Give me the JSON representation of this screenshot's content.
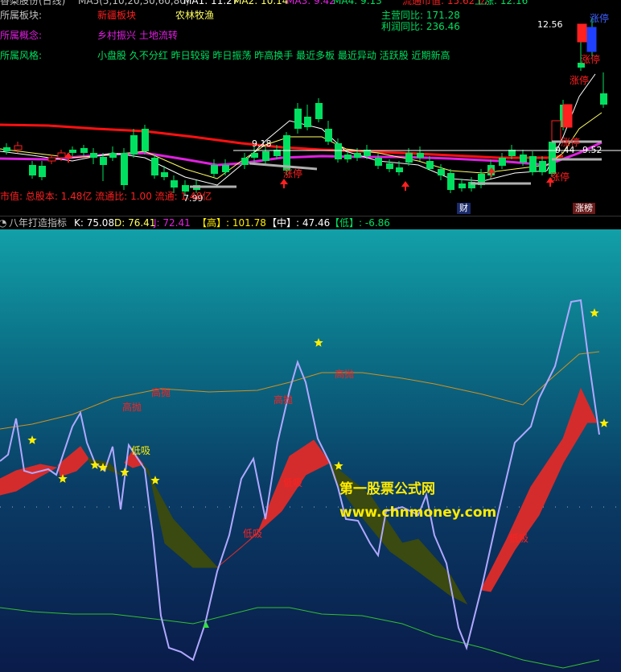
{
  "header": {
    "title": "香梨股份(日线)",
    "ma_line": "MA5(5,10,20,30,60,80)",
    "ma1": "MA1: 11.27",
    "ma2": "MA2: 10.14",
    "ma3": "MA3: 9.42",
    "ma4": "MA4: 9.13",
    "liutong": "流通市值: 15.62 亿",
    "rise": "上涨: 12.16"
  },
  "info": {
    "sector_label": "所属板块:",
    "sector_1": "新疆板块",
    "sector_2": "农林牧渔",
    "concept_label": "所属概念:",
    "concept_value": "乡村振兴 土地流转",
    "style_label": "所属风格:",
    "style_value": "小盘股 久不分红 昨日较弱 昨日振荡 昨高换手 最近多板 最近异动 活跃股 近期新高",
    "revenue_yoy": "主营同比: 171.28",
    "profit_yoy": "利润同比: 236.46"
  },
  "price_labels": {
    "high": "12.56",
    "mid": "9.18",
    "low": "7.99",
    "right_a": "9.44",
    "right_b": "9.52"
  },
  "badges": {
    "zhangting": "涨停",
    "cai": "财",
    "zhangbang": "涨榜"
  },
  "bottom_info": "市值: 总股本: 1.48亿  流通比: 1.00  流通: 1.48亿",
  "indicator": {
    "name": "八年打造指标",
    "k": "K: 75.08",
    "d": "D: 76.41",
    "j": "J: 72.41",
    "gao": "【高】: 101.78",
    "zhong": "【中】: 47.46",
    "di": "【低】: -6.86"
  },
  "signals": {
    "dixi": "低吸",
    "gaopao": "高抛"
  },
  "watermark": {
    "name": "第一股票公式网",
    "url": "www.chnmoney.com"
  },
  "colors": {
    "up": "#ff2020",
    "down": "#00e060",
    "ma_red": "#ff1010",
    "ma_magenta": "#e020e0",
    "ma_yellow": "#ffff60",
    "ribbon_up": "#d42c2c",
    "ribbon_down": "#3a4a10",
    "kdj_line": "#b0a8ff",
    "mid_band": "#d09020",
    "low_band": "#30c030",
    "star": "#ffee00"
  }
}
